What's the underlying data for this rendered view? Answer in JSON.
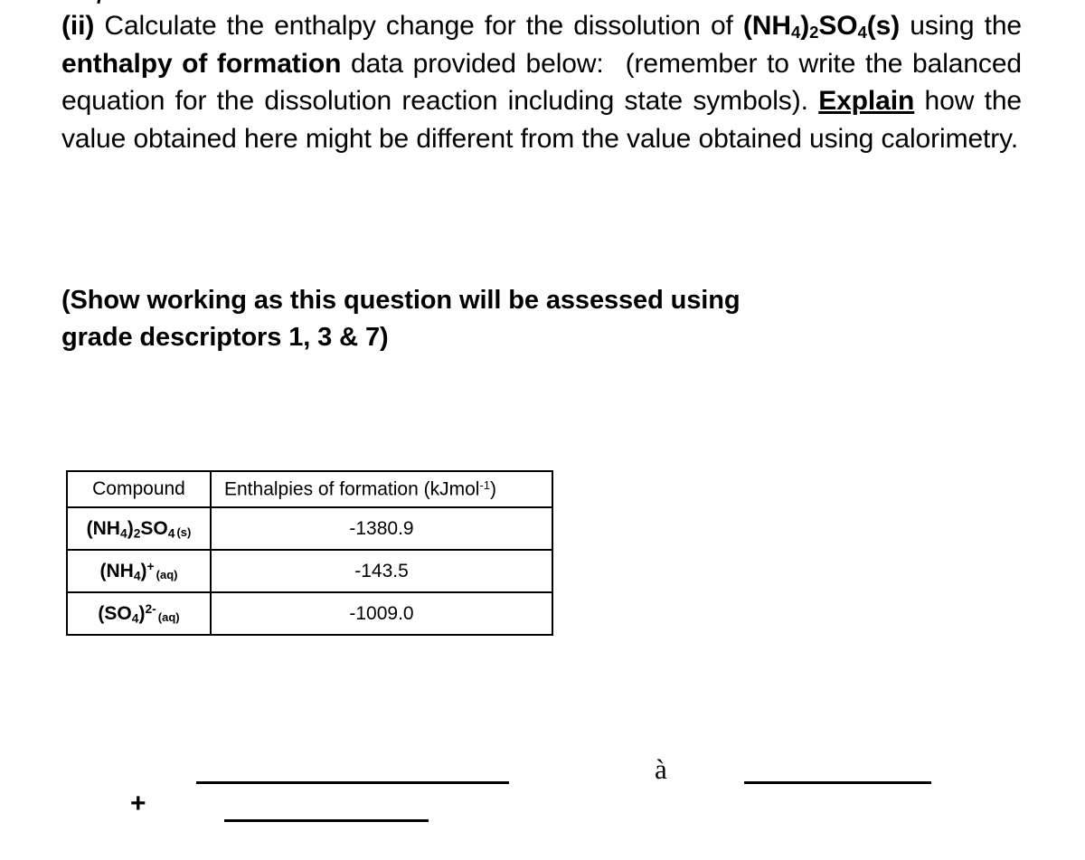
{
  "document": {
    "type": "exam-question-worksheet",
    "background_color": "#ffffff",
    "text_color": "#000000"
  },
  "question": {
    "label": "(ii)",
    "segment_1": "Calculate the enthalpy change for the dissolution of",
    "formula_bold": "(NH4)2SO4(s)",
    "formula_parts": {
      "open": "(NH",
      "sub1": "4",
      "close_sub": ")",
      "sub2": "2",
      "so": "SO",
      "sub3": "4",
      "state": "(s)"
    },
    "segment_2": "using the",
    "emphasis_1": "enthalpy of formation",
    "segment_3": "data provided below:",
    "segment_4": "(remember to write the balanced equation for the dissolution reaction including state symbols).",
    "emphasis_underlined": "Explain",
    "segment_5": "how the value obtained here might be different from the value obtained using calorimetry."
  },
  "note": {
    "line_1": "(Show working as this question will be assessed using",
    "line_2": "grade descriptors 1, 3 & 7)"
  },
  "table": {
    "headers": {
      "compound": "Compound",
      "enthalpies_prefix": "Enthalpies of formation (kJmol",
      "enthalpies_superscript": "-1",
      "enthalpies_suffix": ")"
    },
    "rows": [
      {
        "compound_display": "(NH4)2SO4 (s)",
        "formula": {
          "p1": "(NH",
          "s1": "4",
          "p2": ")",
          "s2": "2",
          "p3": "SO",
          "s3": "4",
          "state": "(s)"
        },
        "value": "-1380.9"
      },
      {
        "compound_display": "(NH4)+ (aq)",
        "formula": {
          "p1": "(NH",
          "s1": "4",
          "p2": ")",
          "sup": "+",
          "state": "(aq)"
        },
        "value": "-143.5"
      },
      {
        "compound_display": "(SO4)2- (aq)",
        "formula": {
          "p1": "(SO",
          "s1": "4",
          "p2": ")",
          "sup": "2-",
          "state": "(aq)"
        },
        "value": "-1009.0"
      }
    ]
  },
  "workspace": {
    "plus_symbol": "+",
    "arrow_glyph": "à",
    "answer_line_1": "",
    "answer_line_2": "",
    "answer_line_3": ""
  }
}
